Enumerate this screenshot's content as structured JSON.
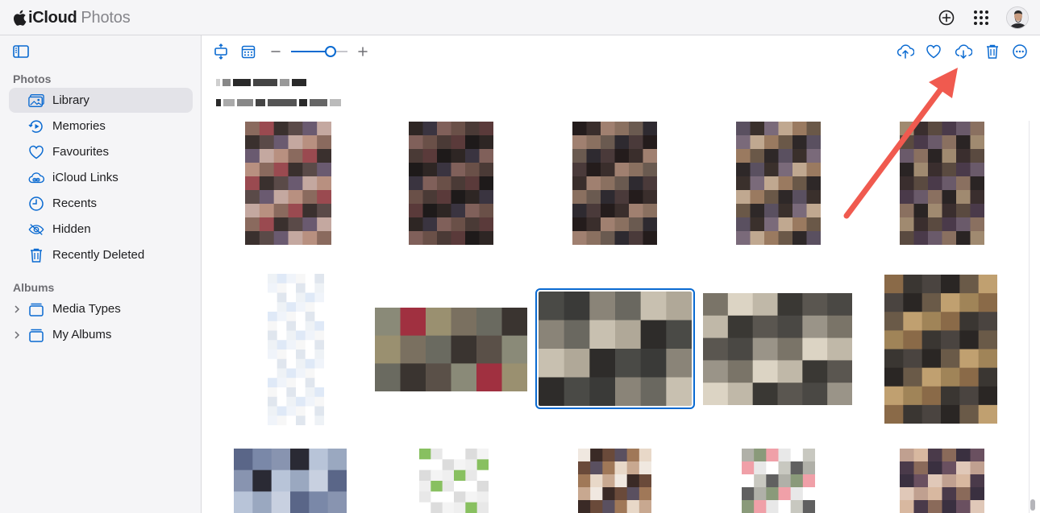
{
  "app": {
    "brand_main": "iCloud",
    "brand_sub": "Photos"
  },
  "header_icons": [
    "add-icon",
    "app-grid-icon",
    "avatar"
  ],
  "sidebar": {
    "photos_heading": "Photos",
    "albums_heading": "Albums",
    "photos_items": [
      {
        "label": "Library",
        "icon": "library-icon",
        "active": true
      },
      {
        "label": "Memories",
        "icon": "memories-icon"
      },
      {
        "label": "Favourites",
        "icon": "heart-icon"
      },
      {
        "label": "iCloud Links",
        "icon": "cloud-link-icon"
      },
      {
        "label": "Recents",
        "icon": "clock-icon"
      },
      {
        "label": "Hidden",
        "icon": "eye-slash-icon"
      },
      {
        "label": "Recently Deleted",
        "icon": "trash-icon"
      }
    ],
    "album_items": [
      {
        "label": "Media Types",
        "icon": "stack-icon"
      },
      {
        "label": "My Albums",
        "icon": "stack-icon"
      }
    ]
  },
  "toolbar": {
    "zoom_level": 0.7,
    "right_actions": [
      "upload-icon",
      "favourite-icon",
      "download-icon",
      "delete-icon",
      "more-icon"
    ]
  },
  "colors": {
    "accent": "#0a6ad1",
    "annotation_arrow": "#f05a4f"
  },
  "photos": [
    {
      "palette": [
        "#8a6a5e",
        "#5a4a48",
        "#b89080",
        "#3a302e",
        "#c4a8a0",
        "#9a4a50",
        "#6a5a70"
      ],
      "selected": false
    },
    {
      "palette": [
        "#4a3a36",
        "#2e2624",
        "#6a5048",
        "#1e1a1a",
        "#80605a",
        "#5a3a3a",
        "#3a3440"
      ],
      "selected": false
    },
    {
      "palette": [
        "#3a2e2c",
        "#6a5a50",
        "#241c1c",
        "#8a7060",
        "#4a3a3a",
        "#a08070",
        "#2e2a30"
      ],
      "selected": false
    },
    {
      "palette": [
        "#6a5848",
        "#3a302c",
        "#9a7a60",
        "#5a5060",
        "#c0a890",
        "#2e2828",
        "#7a6a7a"
      ],
      "selected": false
    },
    {
      "palette": [
        "#5a4a40",
        "#8a7060",
        "#3a2e2e",
        "#6a5a6a",
        "#a08a70",
        "#4a3a4a",
        "#2a2424"
      ],
      "selected": false
    },
    {
      "palette": [
        "#ffffff",
        "#f0f4fa",
        "#e0e6ee",
        "#dfe9f7",
        "#ffffff",
        "#eef2f6",
        "#f7f7f7"
      ],
      "selected": false
    },
    {
      "palette": [
        "#7a7060",
        "#5a5048",
        "#9a9070",
        "#3a3430",
        "#a03040",
        "#6a6a60",
        "#8a8a78"
      ],
      "selected": false
    },
    {
      "palette": [
        "#4a4a46",
        "#6a6860",
        "#2e2c2a",
        "#8a8478",
        "#b0a898",
        "#3a3a38",
        "#c8c0b0"
      ],
      "selected": true
    },
    {
      "palette": [
        "#5a5650",
        "#7a7468",
        "#3a3834",
        "#9a9488",
        "#c0b8a8",
        "#4a4844",
        "#dcd4c4"
      ],
      "selected": false
    },
    {
      "palette": [
        "#3a3632",
        "#6a5a48",
        "#8a6a48",
        "#2a2624",
        "#a08458",
        "#4a4440",
        "#c0a070"
      ],
      "selected": false
    },
    {
      "palette": [
        "#9aa8c0",
        "#7a88a8",
        "#b8c4d8",
        "#5a6688",
        "#2a2a34",
        "#c8d0e0",
        "#8894b0"
      ],
      "selected": false
    },
    {
      "palette": [
        "#ffffff",
        "#f4f4f4",
        "#e8e8e8",
        "#dcdcdc",
        "#88c060",
        "#ffffff",
        "#efefef"
      ],
      "selected": false
    },
    {
      "palette": [
        "#c8a890",
        "#6a4a3a",
        "#e8d8c8",
        "#3a2a26",
        "#a07858",
        "#f0e8e0",
        "#5a5060"
      ],
      "selected": false
    },
    {
      "palette": [
        "#e8e8e8",
        "#606060",
        "#f0a0a8",
        "#c8c8c0",
        "#8a9a7a",
        "#ffffff",
        "#b0b0a8"
      ],
      "selected": false
    },
    {
      "palette": [
        "#c0a090",
        "#8a6a5a",
        "#e0c8b8",
        "#4a3a4a",
        "#6a5060",
        "#d8b8a0",
        "#3a3040"
      ],
      "selected": false
    }
  ]
}
